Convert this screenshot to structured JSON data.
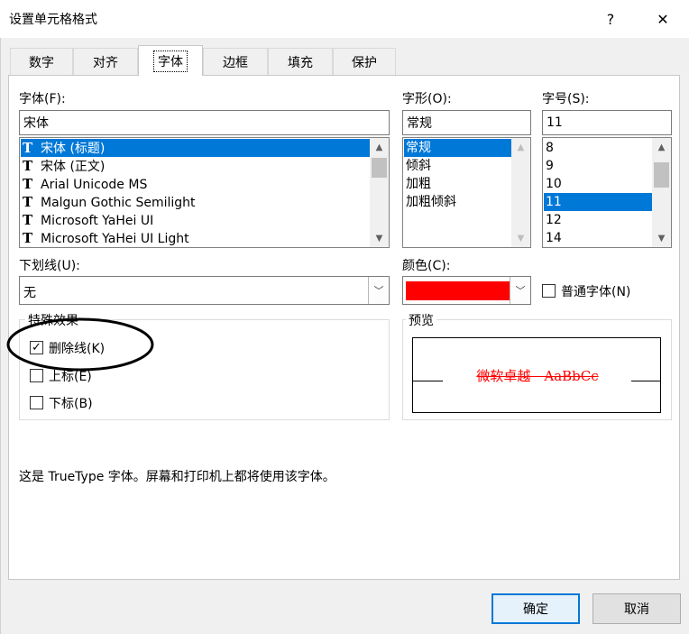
{
  "window": {
    "title": "设置单元格格式",
    "help_glyph": "?",
    "close_glyph": "✕"
  },
  "tabs": [
    "数字",
    "对齐",
    "字体",
    "边框",
    "填充",
    "保护"
  ],
  "font": {
    "label": "字体(F):",
    "value": "宋体",
    "items": [
      "宋体 (标题)",
      "宋体 (正文)",
      "Arial Unicode MS",
      "Malgun Gothic Semilight",
      "Microsoft YaHei UI",
      "Microsoft YaHei UI Light"
    ],
    "selected": "宋体 (标题)",
    "item_icon": "truetype-icon",
    "icon_glyph": "T"
  },
  "style": {
    "label": "字形(O):",
    "value": "常规",
    "items": [
      "常规",
      "倾斜",
      "加粗",
      "加粗倾斜"
    ],
    "selected": "常规"
  },
  "size": {
    "label": "字号(S):",
    "value": "11",
    "items": [
      "8",
      "9",
      "10",
      "11",
      "12",
      "14"
    ],
    "selected": "11"
  },
  "underline": {
    "label": "下划线(U):",
    "value": "无"
  },
  "color": {
    "label": "颜色(C):",
    "value": "#ff0000"
  },
  "normal_font": {
    "label": "普通字体(N)",
    "checked": false
  },
  "effects": {
    "title": "特殊效果",
    "items": [
      {
        "label": "删除线(K)",
        "checked": true
      },
      {
        "label": "上标(E)",
        "checked": false
      },
      {
        "label": "下标(B)",
        "checked": false
      }
    ]
  },
  "preview": {
    "title": "预览",
    "text": "微软卓越　AaBbCc",
    "color": "#ff0000"
  },
  "info": "这是 TrueType 字体。屏幕和打印机上都将使用该字体。",
  "buttons": {
    "ok": "确定",
    "cancel": "取消"
  },
  "annotation": {
    "shape": "ellipse",
    "color": "#000000"
  }
}
